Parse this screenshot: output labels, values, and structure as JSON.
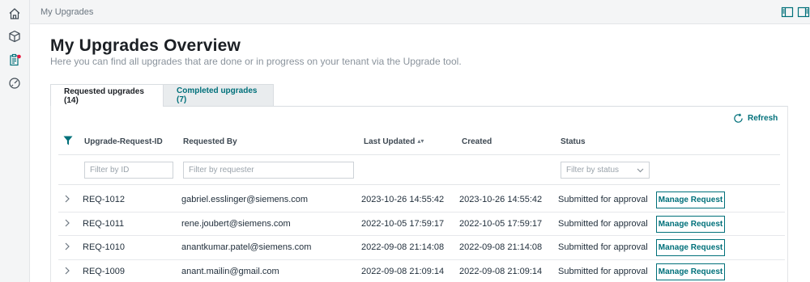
{
  "topbar": {
    "title": "My Upgrades"
  },
  "page": {
    "title": "My Upgrades Overview",
    "subtitle": "Here you can find all upgrades that are done or in progress on your tenant via the Upgrade tool."
  },
  "tabs": [
    {
      "label": "Requested upgrades (14)",
      "active": true
    },
    {
      "label": "Completed upgrades (7)",
      "active": false
    }
  ],
  "refresh_label": "Refresh",
  "columns": {
    "id": "Upgrade-Request-ID",
    "requested_by": "Requested By",
    "last_updated": "Last Updated",
    "created": "Created",
    "status": "Status"
  },
  "filters": {
    "id_placeholder": "Filter by ID",
    "requester_placeholder": "Filter by requester",
    "status_placeholder": "Filter by status"
  },
  "rows": [
    {
      "id": "REQ-1012",
      "requested_by": "gabriel.esslinger@siemens.com",
      "last_updated": "2023-10-26 14:55:42",
      "created": "2023-10-26 14:55:42",
      "status": "Submitted for approval",
      "action": "Manage Request"
    },
    {
      "id": "REQ-1011",
      "requested_by": "rene.joubert@siemens.com",
      "last_updated": "2022-10-05 17:59:17",
      "created": "2022-10-05 17:59:17",
      "status": "Submitted for approval",
      "action": "Manage Request"
    },
    {
      "id": "REQ-1010",
      "requested_by": "anantkumar.patel@siemens.com",
      "last_updated": "2022-09-08 21:14:08",
      "created": "2022-09-08 21:14:08",
      "status": "Submitted for approval",
      "action": "Manage Request"
    },
    {
      "id": "REQ-1009",
      "requested_by": "anant.mailin@gmail.com",
      "last_updated": "2022-09-08 21:09:14",
      "created": "2022-09-08 21:09:14",
      "status": "Submitted for approval",
      "action": "Manage Request"
    }
  ],
  "colors": {
    "accent": "#00707a",
    "notification": "#e8173d"
  }
}
